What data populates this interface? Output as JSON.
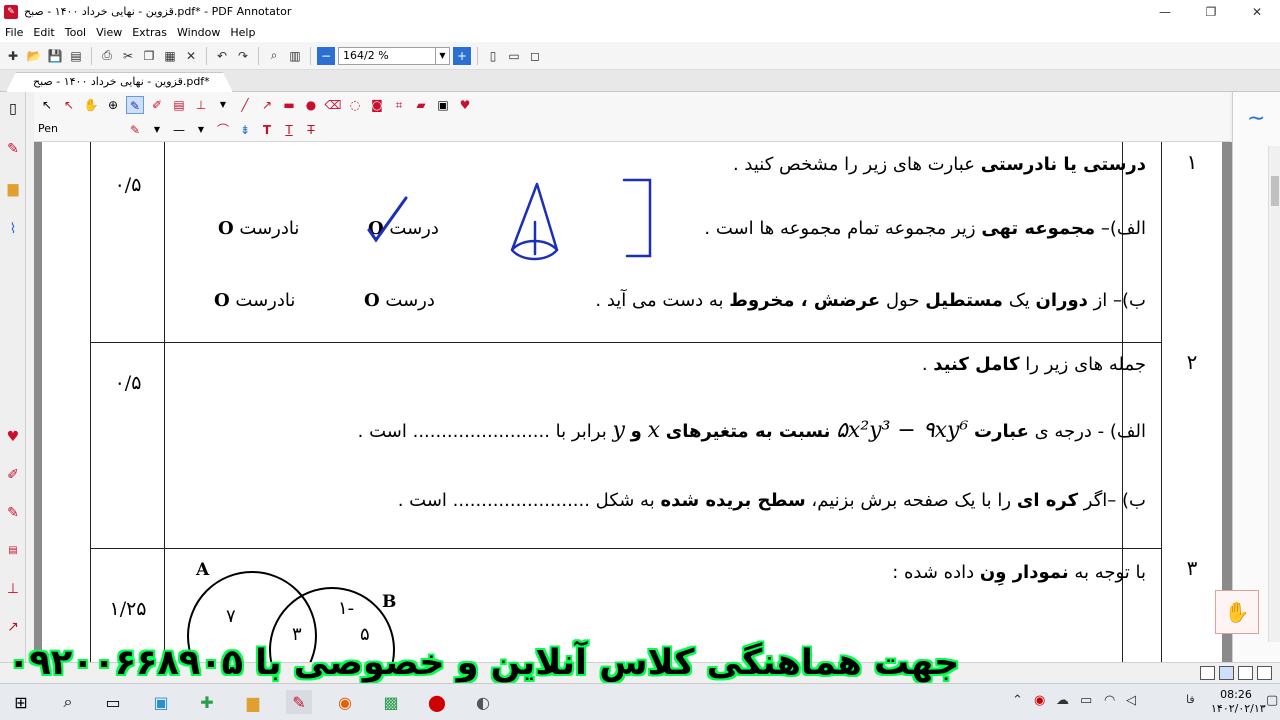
{
  "window": {
    "title": "قزوین - نهایی خرداد ۱۴۰۰ - صبح.pdf* - PDF Annotator",
    "controls": [
      "—",
      "❐",
      "✕"
    ]
  },
  "menu": [
    "File",
    "Edit",
    "Tool",
    "View",
    "Extras",
    "Window",
    "Help"
  ],
  "toolbar": {
    "zoom": "164/2 %"
  },
  "tab": {
    "label": "قزوین - نهایی خرداد ۱۴۰۰ - صبح.pdf*"
  },
  "pen_toolbar": {
    "label": "Pen"
  },
  "questions": [
    {
      "number": "۱",
      "score": "۰/۵",
      "intro_bold": "درستی یا نادرستی",
      "intro_rest": "عبارت های زیر را مشخص کنید .",
      "a_text_1": "الف)–",
      "a_bold": "مجموعه تهی",
      "a_text_2": "زیر مجموعه تمام مجموعه ها است .",
      "b_text_1": "ب)– از",
      "b_bold_1": "دوران",
      "b_text_2": "یک",
      "b_bold_2": "مستطیل",
      "b_text_3": "حول",
      "b_bold_3": "عرضش ، مخروط",
      "b_text_4": "به دست می آید .",
      "true_label": "درست",
      "false_label": "نادرست",
      "mark": "O"
    },
    {
      "number": "۲",
      "score": "۰/۵",
      "intro_text": "جمله های زیر را",
      "intro_bold": "کامل کنید",
      "intro_end": ".",
      "a_text_1": "الف) - درجه ی",
      "a_bold": "عبارت",
      "a_expr": "۵x²y³ − ۹xy⁶",
      "a_bold_2": "نسبت به متغیرهای",
      "a_var_x": "x",
      "a_and": "و",
      "a_var_y": "y",
      "a_text_2": "برابر با ........................ است .",
      "b_text_1": "ب) –اگر",
      "b_bold_1": "کره ای",
      "b_text_2": "را با یک صفحه برش بزنیم،",
      "b_bold_2": "سطح بریده شده",
      "b_text_3": "به شکل ........................  است ."
    },
    {
      "number": "۳",
      "score": "۱/۲۵",
      "intro_text": "با توجه به",
      "intro_bold": "نمودار وِن",
      "intro_end": "داده شده :",
      "venn": {
        "label_a": "A",
        "label_b": "B",
        "region_a": "۷",
        "region_ab": "۳",
        "region_b1": "۱-",
        "region_b2": "۵"
      }
    }
  ],
  "banner": "جهت هماهنگی کلاس آنلاین و خصوصی با ۰۹۲۰۰۶۶۸۹۰۵",
  "taskbar": {
    "lang": "فا",
    "time": "08:26",
    "date": "۱۴۰۲/۰۲/۱۳"
  },
  "colors": {
    "ink": "#1b2fb8",
    "banner_green": "#00ff4c",
    "accent_red": "#c8102e"
  }
}
